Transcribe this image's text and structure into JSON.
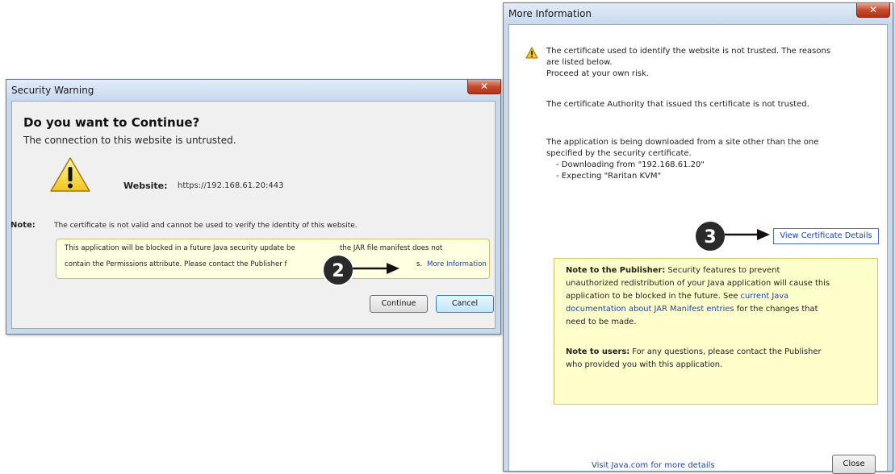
{
  "security_warning": {
    "title": "Security Warning",
    "heading": "Do you want to Continue?",
    "subheading": "The connection to this website is untrusted.",
    "website_label": "Website:",
    "website_value": "https://192.168.61.20:443",
    "note_label": "Note:",
    "note_text": "The certificate is not valid and cannot be used to verify the identity of this website.",
    "yellow_line1_a": "This application will be blocked in a future Java security update be",
    "yellow_line1_b": "the JAR file manifest does not",
    "yellow_line2": "contain the Permissions attribute. Please contact the Publisher f",
    "yellow_line2_b": "s.",
    "more_info_link": "More Information",
    "continue_label": "Continue",
    "cancel_label": "Cancel"
  },
  "more_information": {
    "title": "More Information",
    "intro_line1": "The certificate used to identify the website is not trusted.  The reasons",
    "intro_line2": "are listed below.",
    "intro_line3": "Proceed at your own risk.",
    "authority_text": "The certificate Authority that issued ths certificate is not trusted.",
    "download_line1": "The application is being downloaded from a site other than the one",
    "download_line2": "specified by the security certificate.",
    "download_line3": "- Downloading from \"192.168.61.20\"",
    "download_line4": "- Expecting \"Raritan KVM\"",
    "view_cert_link": "View Certificate Details",
    "publisher_label": "Note to the Publisher:",
    "publisher_line1": " Security features to prevent",
    "publisher_line2": "unauthorized redistribution of your Java application will cause this",
    "publisher_line3": "application to be blocked in the future. See ",
    "publisher_link_1": "current Java",
    "publisher_link_2": "documentation about JAR Manifest entries",
    "publisher_line5": " for the changes that",
    "publisher_line6": "need to be made.",
    "users_label": "Note to users:",
    "users_line1": " For any questions, please contact the Publisher",
    "users_line2": "who provided you with this application.",
    "visit_link": "Visit Java.com for more details",
    "close_label": "Close"
  },
  "callouts": {
    "step2": "2",
    "step3": "3"
  },
  "icons": {
    "warning": "warning-icon",
    "close": "close-icon"
  },
  "colors": {
    "link": "#1a45b8",
    "note_bg": "#ffffcc",
    "close_red": "#c74a2c"
  }
}
